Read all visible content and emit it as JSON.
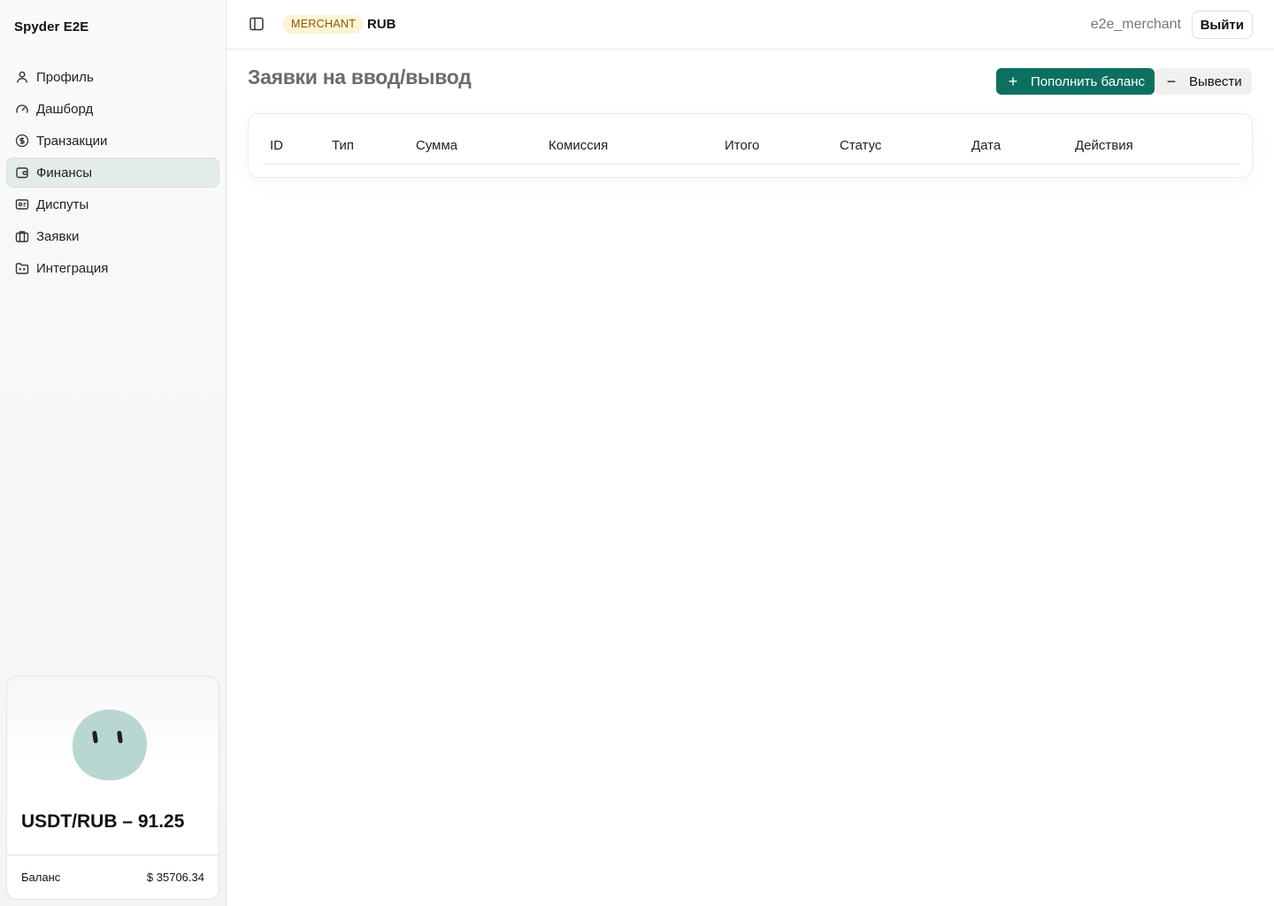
{
  "sidebar": {
    "brand": "Spyder E2E",
    "items": [
      {
        "label": "Профиль",
        "icon": "user-icon",
        "active": false
      },
      {
        "label": "Дашборд",
        "icon": "gauge-icon",
        "active": false
      },
      {
        "label": "Транзакции",
        "icon": "dollar-circle-icon",
        "active": false
      },
      {
        "label": "Финансы",
        "icon": "wallet-icon",
        "active": true
      },
      {
        "label": "Диспуты",
        "icon": "card-icon",
        "active": false
      },
      {
        "label": "Заявки",
        "icon": "briefcase-icon",
        "active": false
      },
      {
        "label": "Интеграция",
        "icon": "folder-code-icon",
        "active": false
      }
    ],
    "rate_card": {
      "rate": "USDT/RUB – 91.25",
      "balance_label": "Баланс",
      "balance_value": "$ 35706.34"
    }
  },
  "header": {
    "role_badge": "MERCHANT",
    "currency": "RUB",
    "username": "e2e_merchant",
    "logout_label": "Выйти"
  },
  "main": {
    "title": "Заявки на ввод/вывод",
    "deposit_label": "Пополнить баланс",
    "withdraw_label": "Вывести",
    "columns": [
      "ID",
      "Тип",
      "Сумма",
      "Комиссия",
      "Итого",
      "Статус",
      "Дата",
      "Действия"
    ]
  },
  "colors": {
    "accent": "#0b7060",
    "badge_bg": "#fdf3d6",
    "badge_text": "#8a5c00",
    "active_nav_bg": "#e4ecea",
    "blob": "#b8d6d2"
  }
}
